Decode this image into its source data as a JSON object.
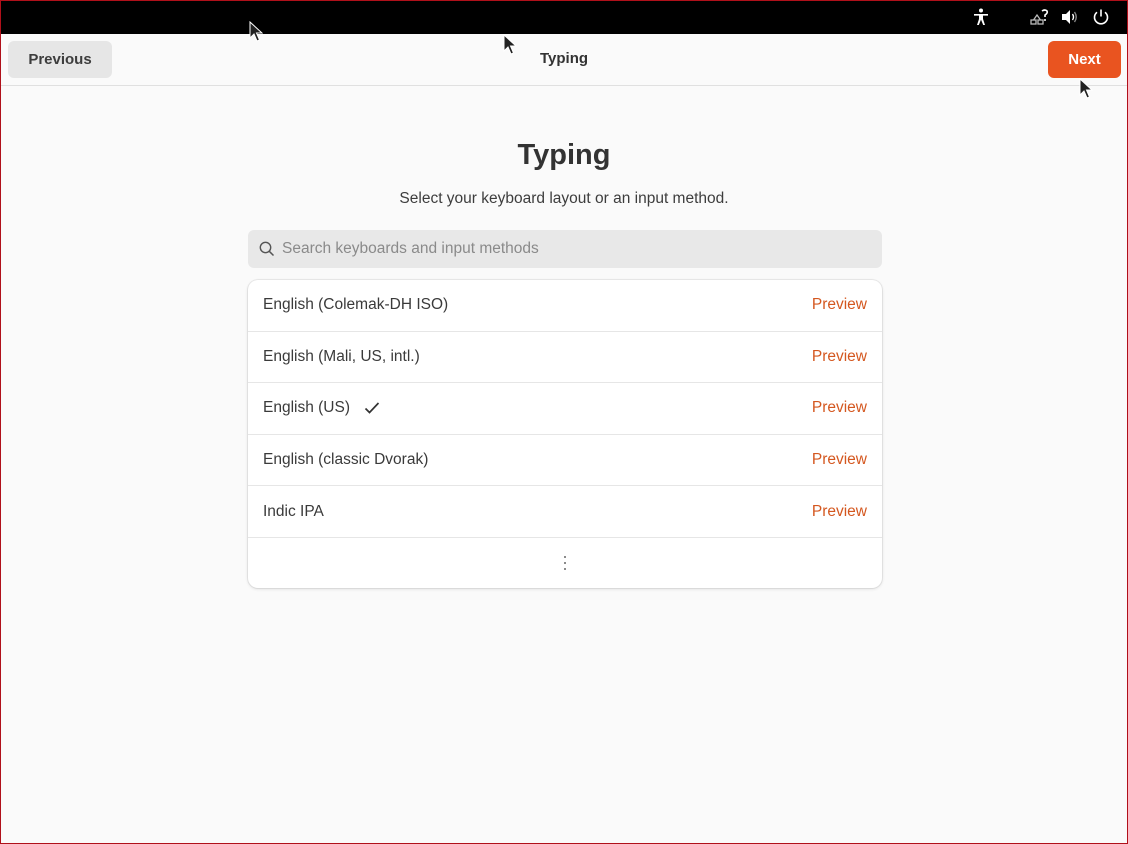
{
  "system_bar": {
    "icons": [
      "accessibility-icon",
      "network-icon",
      "volume-icon",
      "power-icon"
    ]
  },
  "header": {
    "title": "Typing",
    "previous_label": "Previous",
    "next_label": "Next"
  },
  "main": {
    "title": "Typing",
    "subtitle": "Select your keyboard layout or an input method.",
    "search": {
      "placeholder": "Search keyboards and input methods",
      "value": ""
    },
    "layouts": [
      {
        "label": "English (Colemak-DH ISO)",
        "selected": false,
        "action": "Preview"
      },
      {
        "label": "English (Mali, US, intl.)",
        "selected": false,
        "action": "Preview"
      },
      {
        "label": "English (US)",
        "selected": true,
        "action": "Preview"
      },
      {
        "label": "English (classic Dvorak)",
        "selected": false,
        "action": "Preview"
      },
      {
        "label": "Indic IPA",
        "selected": false,
        "action": "Preview"
      }
    ]
  },
  "colors": {
    "accent": "#e95420",
    "link": "#d4571f",
    "topbar": "#000000",
    "background": "#fafafa"
  }
}
